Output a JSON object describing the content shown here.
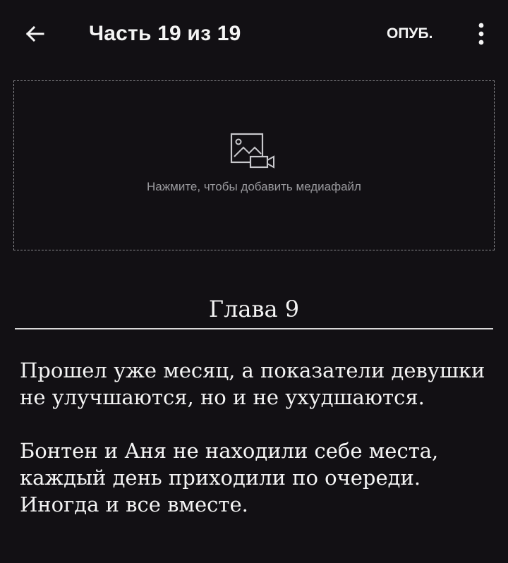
{
  "header": {
    "back_icon": "arrow-left-icon",
    "title": "Часть 19 из 19",
    "publish_label": "ОПУБ.",
    "more_icon": "vertical-dots-icon"
  },
  "media": {
    "icon": "image-video-icon",
    "hint": "Нажмите, чтобы добавить медиафайл"
  },
  "chapter": {
    "heading": "Глава 9",
    "paragraphs": [
      "Прошел уже месяц, а показатели девушки не улучшаются, но и не ухудшаются.",
      "Бонтен и Аня не находили себе места, каждый день приходили по очереди. Иногда и все вместе."
    ]
  }
}
